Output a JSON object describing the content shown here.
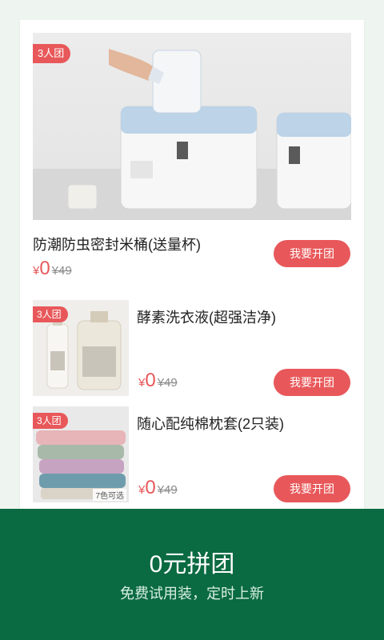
{
  "products": [
    {
      "tag": "3人团",
      "title": "防潮防虫密封米桶(送量杯)",
      "currency": "¥",
      "price": "0",
      "old_price": "¥49",
      "button": "我要开团"
    },
    {
      "tag": "3人团",
      "title": "酵素洗衣液(超强洁净)",
      "currency": "¥",
      "price": "0",
      "old_price": "¥49",
      "button": "我要开团"
    },
    {
      "tag": "3人团",
      "title": "随心配纯棉枕套(2只装)",
      "currency": "¥",
      "price": "0",
      "old_price": "¥49",
      "button": "我要开团",
      "image_badge": "7色可选"
    }
  ],
  "footer": {
    "title": "0元拼团",
    "subtitle": "免费试用装，定时上新"
  },
  "colors": {
    "accent": "#e8585a",
    "footer_bg": "#0a6a42",
    "page_bg": "#eef5f1"
  }
}
